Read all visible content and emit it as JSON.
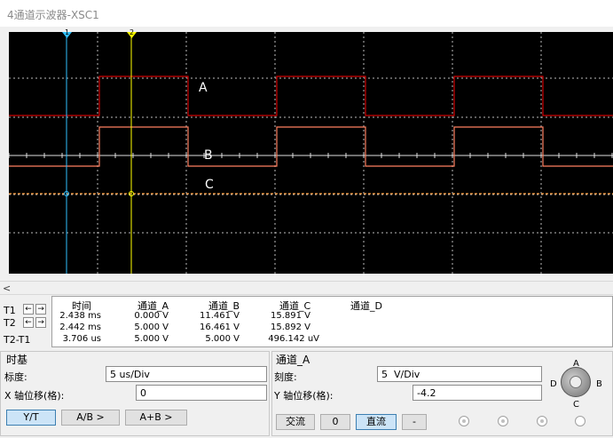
{
  "window": {
    "title": "4通道示波器-XSC1"
  },
  "scope": {
    "trace_labels": {
      "a": "A",
      "b": "B",
      "c": "C"
    },
    "colors": {
      "background": "#000000",
      "grid": "#bcbcbc",
      "trace_a": "#d00000",
      "trace_b": "#ff8060",
      "trace_c": "#ffa040",
      "cursor_t1": "#30c0ff",
      "cursor_t2": "#ffff00"
    },
    "cursor_labels": {
      "t1": "1",
      "t2": "2"
    }
  },
  "scrollbar": {
    "left_arrow": "<"
  },
  "readout": {
    "rows": [
      "T1",
      "T2",
      "T2-T1"
    ],
    "headers": [
      "时间",
      "通道_A",
      "通道_B",
      "通道_C",
      "通道_D"
    ],
    "t1": {
      "time": "2.438 ms",
      "a": "0.000 V",
      "b": "11.461 V",
      "c": "15.891 V",
      "d": ""
    },
    "t2": {
      "time": "2.442 ms",
      "a": "5.000 V",
      "b": "16.461 V",
      "c": "15.892 V",
      "d": ""
    },
    "delta": {
      "time": "3.706 us",
      "a": "5.000 V",
      "b": "5.000 V",
      "c": "496.142 uV",
      "d": ""
    },
    "arrow_left": "←",
    "arrow_right": "→"
  },
  "timebase": {
    "title": "时基",
    "scale_label": "标度:",
    "scale_value": "5 us/Div",
    "x_offset_label": "X 轴位移(格):",
    "x_offset_value": "0",
    "buttons": {
      "yt": "Y/T",
      "ab": "A/B >",
      "aplusb": "A+B >"
    }
  },
  "channel": {
    "title": "通道_A",
    "scale_label": "刻度:",
    "scale_value": "5  V/Div",
    "y_offset_label": "Y 轴位移(格):",
    "y_offset_value": "-4.2",
    "buttons": {
      "ac": "交流",
      "zero": "0",
      "dc": "直流",
      "minus": "-"
    },
    "selector": {
      "a": "A",
      "b": "B",
      "c": "C",
      "d": "D",
      "selected": "A"
    }
  }
}
